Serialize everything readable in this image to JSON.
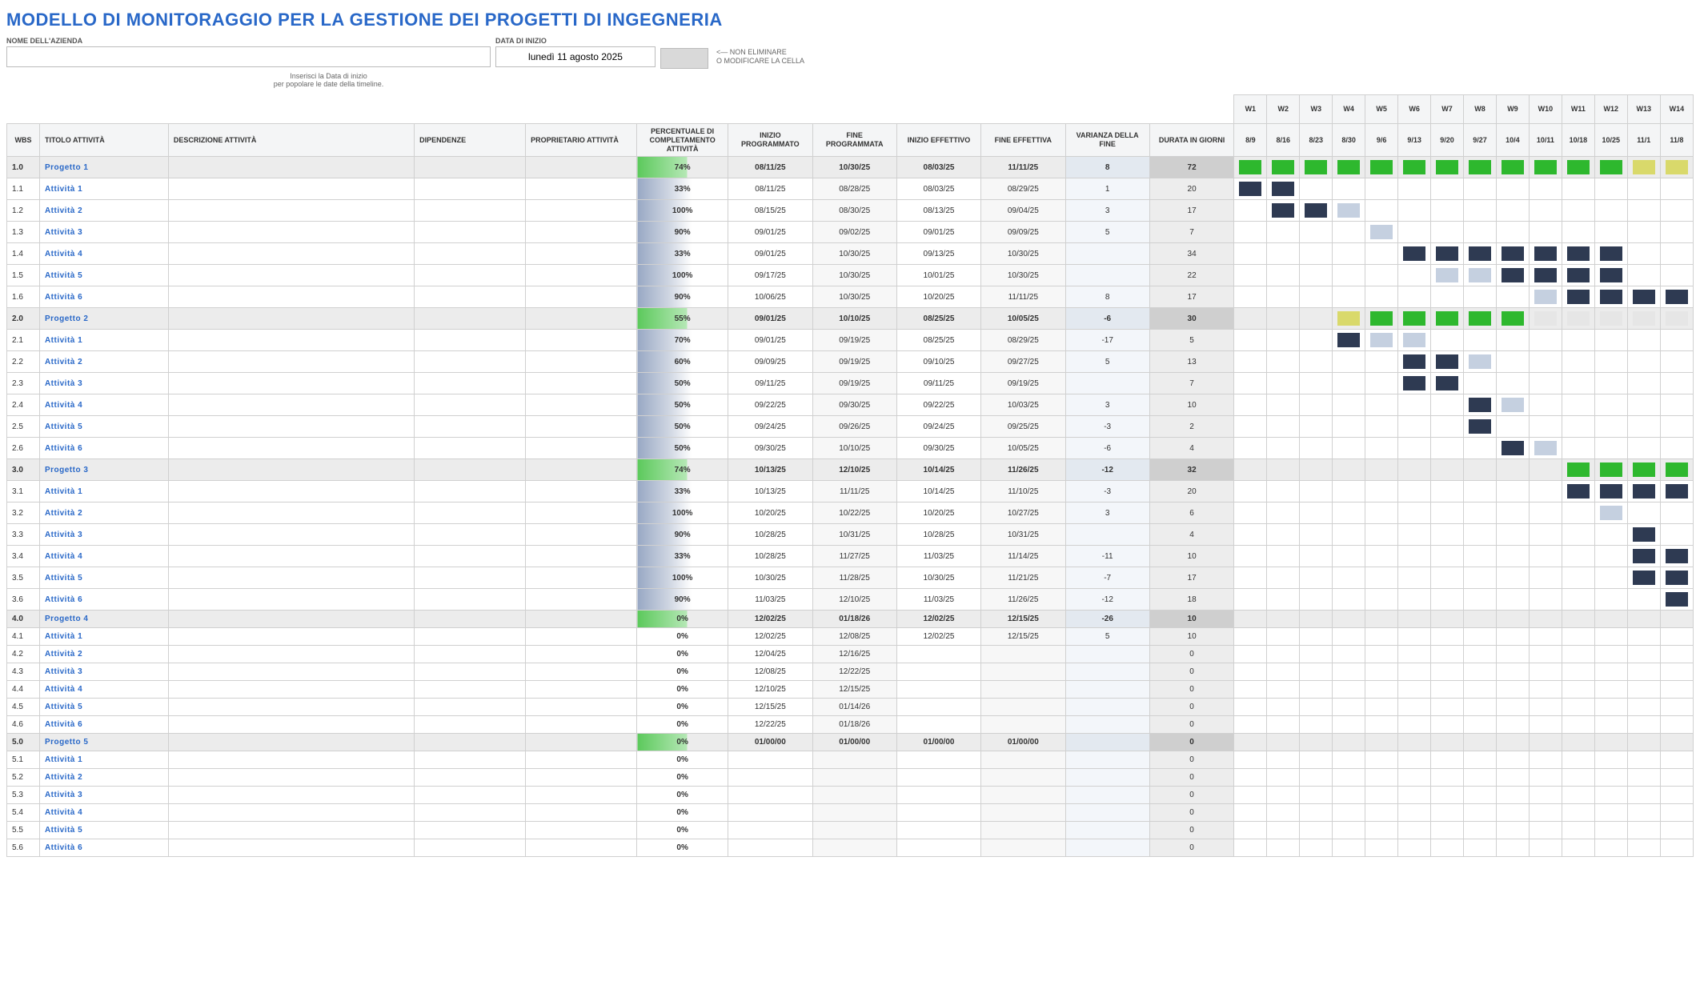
{
  "page_title": "MODELLO DI MONITORAGGIO PER LA GESTIONE DEI PROGETTI DI INGEGNERIA",
  "labels": {
    "company": "NOME DELL'AZIENDA",
    "start_date": "DATA DI INIZIO",
    "warn1": "<― NON ELIMINARE",
    "warn2": "O MODIFICARE LA CELLA",
    "hint1": "Inserisci la Data di inizio",
    "hint2": "per popolare le date della timeline."
  },
  "inputs": {
    "company_value": "",
    "start_date_value": "lunedì 11 agosto 2025"
  },
  "columns": {
    "wbs": "WBS",
    "title": "TITOLO ATTIVITÀ",
    "desc": "DESCRIZIONE ATTIVITÀ",
    "dep": "DIPENDENZE",
    "owner": "PROPRIETARIO ATTIVITÀ",
    "pct": "PERCENTUALE DI COMPLETAMENTO ATTIVITÀ",
    "plan_start": "INIZIO PROGRAMMATO",
    "plan_end": "FINE PROGRAMMATA",
    "act_start": "INIZIO EFFETTIVO",
    "act_end": "FINE EFFETTIVA",
    "var": "VARIANZA DELLA FINE",
    "dur": "DURATA IN GIORNI"
  },
  "weeks": {
    "labels": [
      "W1",
      "W2",
      "W3",
      "W4",
      "W5",
      "W6",
      "W7",
      "W8",
      "W9",
      "W10",
      "W11",
      "W12",
      "W13",
      "W14"
    ],
    "dates": [
      "8/9",
      "8/16",
      "8/23",
      "8/30",
      "9/6",
      "9/13",
      "9/20",
      "9/27",
      "10/4",
      "10/11",
      "10/18",
      "10/25",
      "11/1",
      "11/8"
    ]
  },
  "rows": [
    {
      "wbs": "1.0",
      "title": "Progetto 1",
      "summary": true,
      "pct": "74%",
      "ps": "08/11/25",
      "pe": "10/30/25",
      "as": "08/03/25",
      "ae": "11/11/25",
      "var": "8",
      "dur": "72",
      "gantt": [
        "g",
        "g",
        "g",
        "g",
        "g",
        "g",
        "g",
        "g",
        "g",
        "g",
        "g",
        "g",
        "y",
        "y"
      ]
    },
    {
      "wbs": "1.1",
      "title": "Attività 1",
      "pct": "33%",
      "ps": "08/11/25",
      "pe": "08/28/25",
      "as": "08/03/25",
      "ae": "08/29/25",
      "var": "1",
      "dur": "20",
      "gantt": [
        "n",
        "n",
        "",
        "",
        "",
        "",
        "",
        "",
        "",
        "",
        "",
        "",
        "",
        ""
      ]
    },
    {
      "wbs": "1.2",
      "title": "Attività 2",
      "pct": "100%",
      "ps": "08/15/25",
      "pe": "08/30/25",
      "as": "08/13/25",
      "ae": "09/04/25",
      "var": "3",
      "dur": "17",
      "gantt": [
        "",
        "n",
        "n",
        "l",
        "",
        "",
        "",
        "",
        "",
        "",
        "",
        "",
        "",
        ""
      ]
    },
    {
      "wbs": "1.3",
      "title": "Attività 3",
      "pct": "90%",
      "ps": "09/01/25",
      "pe": "09/02/25",
      "as": "09/01/25",
      "ae": "09/09/25",
      "var": "5",
      "dur": "7",
      "gantt": [
        "",
        "",
        "",
        "",
        "l",
        "",
        "",
        "",
        "",
        "",
        "",
        "",
        "",
        ""
      ]
    },
    {
      "wbs": "1.4",
      "title": "Attività 4",
      "pct": "33%",
      "ps": "09/01/25",
      "pe": "10/30/25",
      "as": "09/13/25",
      "ae": "10/30/25",
      "var": "",
      "dur": "34",
      "gantt": [
        "",
        "",
        "",
        "",
        "",
        "n",
        "n",
        "n",
        "n",
        "n",
        "n",
        "n",
        "",
        ""
      ]
    },
    {
      "wbs": "1.5",
      "title": "Attività 5",
      "pct": "100%",
      "ps": "09/17/25",
      "pe": "10/30/25",
      "as": "10/01/25",
      "ae": "10/30/25",
      "var": "",
      "dur": "22",
      "gantt": [
        "",
        "",
        "",
        "",
        "",
        "",
        "l",
        "l",
        "n",
        "n",
        "n",
        "n",
        "",
        ""
      ]
    },
    {
      "wbs": "1.6",
      "title": "Attività 6",
      "pct": "90%",
      "ps": "10/06/25",
      "pe": "10/30/25",
      "as": "10/20/25",
      "ae": "11/11/25",
      "var": "8",
      "dur": "17",
      "gantt": [
        "",
        "",
        "",
        "",
        "",
        "",
        "",
        "",
        "",
        "l",
        "n",
        "n",
        "n",
        "n"
      ]
    },
    {
      "wbs": "2.0",
      "title": "Progetto 2",
      "summary": true,
      "pct": "55%",
      "ps": "09/01/25",
      "pe": "10/10/25",
      "as": "08/25/25",
      "ae": "10/05/25",
      "var": "-6",
      "dur": "30",
      "gantt": [
        "",
        "",
        "",
        "y",
        "g",
        "g",
        "g",
        "g",
        "g",
        "e",
        "e",
        "e",
        "e",
        "e"
      ]
    },
    {
      "wbs": "2.1",
      "title": "Attività 1",
      "pct": "70%",
      "ps": "09/01/25",
      "pe": "09/19/25",
      "as": "08/25/25",
      "ae": "08/29/25",
      "var": "-17",
      "dur": "5",
      "gantt": [
        "",
        "",
        "",
        "n",
        "l",
        "l",
        "",
        "",
        "",
        "",
        "",
        "",
        "",
        ""
      ]
    },
    {
      "wbs": "2.2",
      "title": "Attività 2",
      "pct": "60%",
      "ps": "09/09/25",
      "pe": "09/19/25",
      "as": "09/10/25",
      "ae": "09/27/25",
      "var": "5",
      "dur": "13",
      "gantt": [
        "",
        "",
        "",
        "",
        "",
        "n",
        "n",
        "l",
        "",
        "",
        "",
        "",
        "",
        ""
      ]
    },
    {
      "wbs": "2.3",
      "title": "Attività 3",
      "pct": "50%",
      "ps": "09/11/25",
      "pe": "09/19/25",
      "as": "09/11/25",
      "ae": "09/19/25",
      "var": "",
      "dur": "7",
      "gantt": [
        "",
        "",
        "",
        "",
        "",
        "n",
        "n",
        "",
        "",
        "",
        "",
        "",
        "",
        ""
      ]
    },
    {
      "wbs": "2.4",
      "title": "Attività 4",
      "pct": "50%",
      "ps": "09/22/25",
      "pe": "09/30/25",
      "as": "09/22/25",
      "ae": "10/03/25",
      "var": "3",
      "dur": "10",
      "gantt": [
        "",
        "",
        "",
        "",
        "",
        "",
        "",
        "n",
        "l",
        "",
        "",
        "",
        "",
        ""
      ]
    },
    {
      "wbs": "2.5",
      "title": "Attività 5",
      "pct": "50%",
      "ps": "09/24/25",
      "pe": "09/26/25",
      "as": "09/24/25",
      "ae": "09/25/25",
      "var": "-3",
      "dur": "2",
      "gantt": [
        "",
        "",
        "",
        "",
        "",
        "",
        "",
        "n",
        "",
        "",
        "",
        "",
        "",
        ""
      ]
    },
    {
      "wbs": "2.6",
      "title": "Attività 6",
      "pct": "50%",
      "ps": "09/30/25",
      "pe": "10/10/25",
      "as": "09/30/25",
      "ae": "10/05/25",
      "var": "-6",
      "dur": "4",
      "gantt": [
        "",
        "",
        "",
        "",
        "",
        "",
        "",
        "",
        "n",
        "l",
        "",
        "",
        "",
        ""
      ]
    },
    {
      "wbs": "3.0",
      "title": "Progetto 3",
      "summary": true,
      "pct": "74%",
      "ps": "10/13/25",
      "pe": "12/10/25",
      "as": "10/14/25",
      "ae": "11/26/25",
      "var": "-12",
      "dur": "32",
      "gantt": [
        "",
        "",
        "",
        "",
        "",
        "",
        "",
        "",
        "",
        "",
        "g",
        "g",
        "g",
        "g"
      ]
    },
    {
      "wbs": "3.1",
      "title": "Attività 1",
      "pct": "33%",
      "ps": "10/13/25",
      "pe": "11/11/25",
      "as": "10/14/25",
      "ae": "11/10/25",
      "var": "-3",
      "dur": "20",
      "gantt": [
        "",
        "",
        "",
        "",
        "",
        "",
        "",
        "",
        "",
        "",
        "n",
        "n",
        "n",
        "n"
      ]
    },
    {
      "wbs": "3.2",
      "title": "Attività 2",
      "pct": "100%",
      "ps": "10/20/25",
      "pe": "10/22/25",
      "as": "10/20/25",
      "ae": "10/27/25",
      "var": "3",
      "dur": "6",
      "gantt": [
        "",
        "",
        "",
        "",
        "",
        "",
        "",
        "",
        "",
        "",
        "",
        "l",
        "",
        ""
      ]
    },
    {
      "wbs": "3.3",
      "title": "Attività 3",
      "pct": "90%",
      "ps": "10/28/25",
      "pe": "10/31/25",
      "as": "10/28/25",
      "ae": "10/31/25",
      "var": "",
      "dur": "4",
      "gantt": [
        "",
        "",
        "",
        "",
        "",
        "",
        "",
        "",
        "",
        "",
        "",
        "",
        "n",
        ""
      ]
    },
    {
      "wbs": "3.4",
      "title": "Attività 4",
      "pct": "33%",
      "ps": "10/28/25",
      "pe": "11/27/25",
      "as": "11/03/25",
      "ae": "11/14/25",
      "var": "-11",
      "dur": "10",
      "gantt": [
        "",
        "",
        "",
        "",
        "",
        "",
        "",
        "",
        "",
        "",
        "",
        "",
        "n",
        "n"
      ]
    },
    {
      "wbs": "3.5",
      "title": "Attività 5",
      "pct": "100%",
      "ps": "10/30/25",
      "pe": "11/28/25",
      "as": "10/30/25",
      "ae": "11/21/25",
      "var": "-7",
      "dur": "17",
      "gantt": [
        "",
        "",
        "",
        "",
        "",
        "",
        "",
        "",
        "",
        "",
        "",
        "",
        "n",
        "n"
      ]
    },
    {
      "wbs": "3.6",
      "title": "Attività 6",
      "pct": "90%",
      "ps": "11/03/25",
      "pe": "12/10/25",
      "as": "11/03/25",
      "ae": "11/26/25",
      "var": "-12",
      "dur": "18",
      "gantt": [
        "",
        "",
        "",
        "",
        "",
        "",
        "",
        "",
        "",
        "",
        "",
        "",
        "",
        "n"
      ]
    },
    {
      "wbs": "4.0",
      "title": "Progetto 4",
      "summary": true,
      "pct": "0%",
      "ps": "12/02/25",
      "pe": "01/18/26",
      "as": "12/02/25",
      "ae": "12/15/25",
      "var": "-26",
      "dur": "10",
      "gantt": [
        "",
        "",
        "",
        "",
        "",
        "",
        "",
        "",
        "",
        "",
        "",
        "",
        "",
        ""
      ],
      "nobar": true
    },
    {
      "wbs": "4.1",
      "title": "Attività 1",
      "pct": "0%",
      "ps": "12/02/25",
      "pe": "12/08/25",
      "as": "12/02/25",
      "ae": "12/15/25",
      "var": "5",
      "dur": "10",
      "nobar": true,
      "gantt": [
        "",
        "",
        "",
        "",
        "",
        "",
        "",
        "",
        "",
        "",
        "",
        "",
        "",
        ""
      ]
    },
    {
      "wbs": "4.2",
      "title": "Attività 2",
      "pct": "0%",
      "ps": "12/04/25",
      "pe": "12/16/25",
      "as": "",
      "ae": "",
      "var": "",
      "dur": "0",
      "nobar": true,
      "gantt": [
        "",
        "",
        "",
        "",
        "",
        "",
        "",
        "",
        "",
        "",
        "",
        "",
        "",
        ""
      ]
    },
    {
      "wbs": "4.3",
      "title": "Attività 3",
      "pct": "0%",
      "ps": "12/08/25",
      "pe": "12/22/25",
      "as": "",
      "ae": "",
      "var": "",
      "dur": "0",
      "nobar": true,
      "gantt": [
        "",
        "",
        "",
        "",
        "",
        "",
        "",
        "",
        "",
        "",
        "",
        "",
        "",
        ""
      ]
    },
    {
      "wbs": "4.4",
      "title": "Attività 4",
      "pct": "0%",
      "ps": "12/10/25",
      "pe": "12/15/25",
      "as": "",
      "ae": "",
      "var": "",
      "dur": "0",
      "nobar": true,
      "gantt": [
        "",
        "",
        "",
        "",
        "",
        "",
        "",
        "",
        "",
        "",
        "",
        "",
        "",
        ""
      ]
    },
    {
      "wbs": "4.5",
      "title": "Attività 5",
      "pct": "0%",
      "ps": "12/15/25",
      "pe": "01/14/26",
      "as": "",
      "ae": "",
      "var": "",
      "dur": "0",
      "nobar": true,
      "gantt": [
        "",
        "",
        "",
        "",
        "",
        "",
        "",
        "",
        "",
        "",
        "",
        "",
        "",
        ""
      ]
    },
    {
      "wbs": "4.6",
      "title": "Attività 6",
      "pct": "0%",
      "ps": "12/22/25",
      "pe": "01/18/26",
      "as": "",
      "ae": "",
      "var": "",
      "dur": "0",
      "nobar": true,
      "gantt": [
        "",
        "",
        "",
        "",
        "",
        "",
        "",
        "",
        "",
        "",
        "",
        "",
        "",
        ""
      ]
    },
    {
      "wbs": "5.0",
      "title": "Progetto 5",
      "summary": true,
      "pct": "0%",
      "ps": "01/00/00",
      "pe": "01/00/00",
      "as": "01/00/00",
      "ae": "01/00/00",
      "var": "",
      "dur": "0",
      "nobar": true,
      "gantt": [
        "",
        "",
        "",
        "",
        "",
        "",
        "",
        "",
        "",
        "",
        "",
        "",
        "",
        ""
      ]
    },
    {
      "wbs": "5.1",
      "title": "Attività 1",
      "pct": "0%",
      "ps": "",
      "pe": "",
      "as": "",
      "ae": "",
      "var": "",
      "dur": "0",
      "nobar": true,
      "gantt": [
        "",
        "",
        "",
        "",
        "",
        "",
        "",
        "",
        "",
        "",
        "",
        "",
        "",
        ""
      ]
    },
    {
      "wbs": "5.2",
      "title": "Attività 2",
      "pct": "0%",
      "ps": "",
      "pe": "",
      "as": "",
      "ae": "",
      "var": "",
      "dur": "0",
      "nobar": true,
      "gantt": [
        "",
        "",
        "",
        "",
        "",
        "",
        "",
        "",
        "",
        "",
        "",
        "",
        "",
        ""
      ]
    },
    {
      "wbs": "5.3",
      "title": "Attività 3",
      "pct": "0%",
      "ps": "",
      "pe": "",
      "as": "",
      "ae": "",
      "var": "",
      "dur": "0",
      "nobar": true,
      "gantt": [
        "",
        "",
        "",
        "",
        "",
        "",
        "",
        "",
        "",
        "",
        "",
        "",
        "",
        ""
      ]
    },
    {
      "wbs": "5.4",
      "title": "Attività 4",
      "pct": "0%",
      "ps": "",
      "pe": "",
      "as": "",
      "ae": "",
      "var": "",
      "dur": "0",
      "nobar": true,
      "gantt": [
        "",
        "",
        "",
        "",
        "",
        "",
        "",
        "",
        "",
        "",
        "",
        "",
        "",
        ""
      ]
    },
    {
      "wbs": "5.5",
      "title": "Attività 5",
      "pct": "0%",
      "ps": "",
      "pe": "",
      "as": "",
      "ae": "",
      "var": "",
      "dur": "0",
      "nobar": true,
      "gantt": [
        "",
        "",
        "",
        "",
        "",
        "",
        "",
        "",
        "",
        "",
        "",
        "",
        "",
        ""
      ]
    },
    {
      "wbs": "5.6",
      "title": "Attività 6",
      "pct": "0%",
      "ps": "",
      "pe": "",
      "as": "",
      "ae": "",
      "var": "",
      "dur": "0",
      "nobar": true,
      "gantt": [
        "",
        "",
        "",
        "",
        "",
        "",
        "",
        "",
        "",
        "",
        "",
        "",
        "",
        ""
      ]
    }
  ]
}
